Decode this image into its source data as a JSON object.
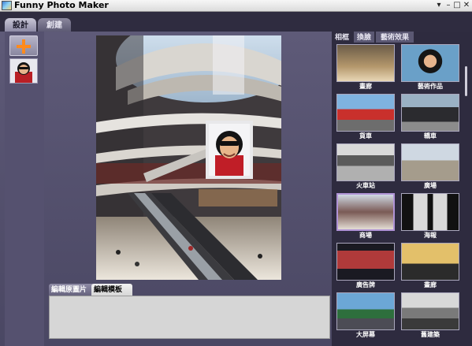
{
  "window": {
    "title": "Funny Photo Maker",
    "controls": {
      "dropdown": "▾",
      "minimize": "–",
      "maximize": "□",
      "close": "✕"
    }
  },
  "top_tabs": {
    "design": "設計",
    "create": "創建"
  },
  "bottom_tabs": {
    "edit_original": "編輯原圖片",
    "edit_template": "編輯模板"
  },
  "right_tabs": {
    "frames": "相框",
    "face_swap": "換臉",
    "art_effects": "藝術效果"
  },
  "gallery": [
    {
      "label": "畫廊"
    },
    {
      "label": "藝術作品"
    },
    {
      "label": "貨車"
    },
    {
      "label": "轎車"
    },
    {
      "label": "火車站"
    },
    {
      "label": "廣場"
    },
    {
      "label": "商場"
    },
    {
      "label": "海報"
    },
    {
      "label": "廣告牌"
    },
    {
      "label": "畫廊"
    },
    {
      "label": "大屏幕"
    },
    {
      "label": "舊建築"
    }
  ],
  "colors": {
    "accent_orange": "#ff8a1c",
    "selected_border": "#b093d6"
  }
}
